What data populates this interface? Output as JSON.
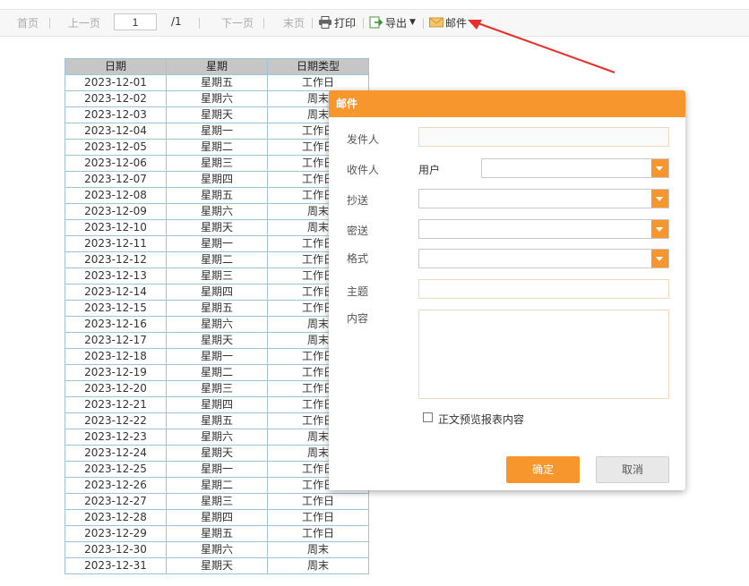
{
  "toolbar": {
    "first": "首页",
    "prev": "上一页",
    "page_value": "1",
    "page_total": "/1",
    "next": "下一页",
    "last": "末页",
    "print": "打印",
    "export": "导出",
    "mail": "邮件"
  },
  "table": {
    "headers": [
      "日期",
      "星期",
      "日期类型"
    ],
    "rows": [
      [
        "2023-12-01",
        "星期五",
        "工作日"
      ],
      [
        "2023-12-02",
        "星期六",
        "周末"
      ],
      [
        "2023-12-03",
        "星期天",
        "周末"
      ],
      [
        "2023-12-04",
        "星期一",
        "工作日"
      ],
      [
        "2023-12-05",
        "星期二",
        "工作日"
      ],
      [
        "2023-12-06",
        "星期三",
        "工作日"
      ],
      [
        "2023-12-07",
        "星期四",
        "工作日"
      ],
      [
        "2023-12-08",
        "星期五",
        "工作日"
      ],
      [
        "2023-12-09",
        "星期六",
        "周末"
      ],
      [
        "2023-12-10",
        "星期天",
        "周末"
      ],
      [
        "2023-12-11",
        "星期一",
        "工作日"
      ],
      [
        "2023-12-12",
        "星期二",
        "工作日"
      ],
      [
        "2023-12-13",
        "星期三",
        "工作日"
      ],
      [
        "2023-12-14",
        "星期四",
        "工作日"
      ],
      [
        "2023-12-15",
        "星期五",
        "工作日"
      ],
      [
        "2023-12-16",
        "星期六",
        "周末"
      ],
      [
        "2023-12-17",
        "星期天",
        "周末"
      ],
      [
        "2023-12-18",
        "星期一",
        "工作日"
      ],
      [
        "2023-12-19",
        "星期二",
        "工作日"
      ],
      [
        "2023-12-20",
        "星期三",
        "工作日"
      ],
      [
        "2023-12-21",
        "星期四",
        "工作日"
      ],
      [
        "2023-12-22",
        "星期五",
        "工作日"
      ],
      [
        "2023-12-23",
        "星期六",
        "周末"
      ],
      [
        "2023-12-24",
        "星期天",
        "周末"
      ],
      [
        "2023-12-25",
        "星期一",
        "工作日"
      ],
      [
        "2023-12-26",
        "星期二",
        "工作日"
      ],
      [
        "2023-12-27",
        "星期三",
        "工作日"
      ],
      [
        "2023-12-28",
        "星期四",
        "工作日"
      ],
      [
        "2023-12-29",
        "星期五",
        "工作日"
      ],
      [
        "2023-12-30",
        "星期六",
        "周末"
      ],
      [
        "2023-12-31",
        "星期天",
        "周末"
      ]
    ]
  },
  "dialog": {
    "title": "邮件",
    "sender_label": "发件人",
    "recipient_label": "收件人",
    "recipient_type": "用户",
    "cc_label": "抄送",
    "bcc_label": "密送",
    "format_label": "格式",
    "subject_label": "主题",
    "content_label": "内容",
    "checkbox_label": "正文预览报表内容",
    "ok": "确定",
    "cancel": "取消"
  },
  "colors": {
    "accent": "#f7962c",
    "arrow": "#e8302a",
    "table_border": "#9ec4dc",
    "table_header": "#c6c6c6"
  }
}
